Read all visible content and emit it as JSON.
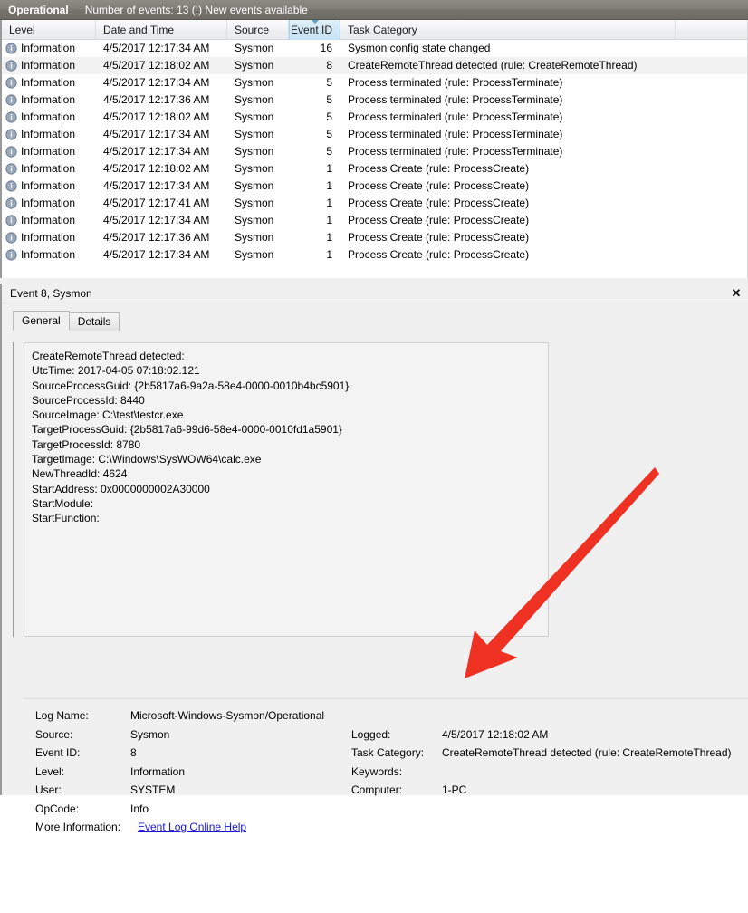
{
  "log_header": {
    "log_name": "Operational",
    "status": "Number of events: 13 (!) New events available"
  },
  "events_list": {
    "columns": [
      {
        "key": "level",
        "label": "Level"
      },
      {
        "key": "date",
        "label": "Date and Time"
      },
      {
        "key": "source",
        "label": "Source"
      },
      {
        "key": "event_id",
        "label": "Event ID"
      },
      {
        "key": "task",
        "label": "Task Category"
      }
    ],
    "sorted_column": "Event ID",
    "rows": [
      {
        "level": "Information",
        "date": "4/5/2017 12:17:34 AM",
        "source": "Sysmon",
        "event_id": "16",
        "task": "Sysmon config state changed",
        "selected": false
      },
      {
        "level": "Information",
        "date": "4/5/2017 12:18:02 AM",
        "source": "Sysmon",
        "event_id": "8",
        "task": "CreateRemoteThread detected (rule: CreateRemoteThread)",
        "selected": true
      },
      {
        "level": "Information",
        "date": "4/5/2017 12:17:34 AM",
        "source": "Sysmon",
        "event_id": "5",
        "task": "Process terminated (rule: ProcessTerminate)",
        "selected": false
      },
      {
        "level": "Information",
        "date": "4/5/2017 12:17:36 AM",
        "source": "Sysmon",
        "event_id": "5",
        "task": "Process terminated (rule: ProcessTerminate)",
        "selected": false
      },
      {
        "level": "Information",
        "date": "4/5/2017 12:18:02 AM",
        "source": "Sysmon",
        "event_id": "5",
        "task": "Process terminated (rule: ProcessTerminate)",
        "selected": false
      },
      {
        "level": "Information",
        "date": "4/5/2017 12:17:34 AM",
        "source": "Sysmon",
        "event_id": "5",
        "task": "Process terminated (rule: ProcessTerminate)",
        "selected": false
      },
      {
        "level": "Information",
        "date": "4/5/2017 12:17:34 AM",
        "source": "Sysmon",
        "event_id": "5",
        "task": "Process terminated (rule: ProcessTerminate)",
        "selected": false
      },
      {
        "level": "Information",
        "date": "4/5/2017 12:18:02 AM",
        "source": "Sysmon",
        "event_id": "1",
        "task": "Process Create (rule: ProcessCreate)",
        "selected": false
      },
      {
        "level": "Information",
        "date": "4/5/2017 12:17:34 AM",
        "source": "Sysmon",
        "event_id": "1",
        "task": "Process Create (rule: ProcessCreate)",
        "selected": false
      },
      {
        "level": "Information",
        "date": "4/5/2017 12:17:41 AM",
        "source": "Sysmon",
        "event_id": "1",
        "task": "Process Create (rule: ProcessCreate)",
        "selected": false
      },
      {
        "level": "Information",
        "date": "4/5/2017 12:17:34 AM",
        "source": "Sysmon",
        "event_id": "1",
        "task": "Process Create (rule: ProcessCreate)",
        "selected": false
      },
      {
        "level": "Information",
        "date": "4/5/2017 12:17:36 AM",
        "source": "Sysmon",
        "event_id": "1",
        "task": "Process Create (rule: ProcessCreate)",
        "selected": false
      },
      {
        "level": "Information",
        "date": "4/5/2017 12:17:34 AM",
        "source": "Sysmon",
        "event_id": "1",
        "task": "Process Create (rule: ProcessCreate)",
        "selected": false
      }
    ]
  },
  "detail": {
    "title": "Event 8, Sysmon",
    "close_label": "✕",
    "tabs": [
      {
        "label": "General",
        "active": true
      },
      {
        "label": "Details",
        "active": false
      }
    ],
    "message_lines": [
      "CreateRemoteThread detected:",
      "UtcTime: 2017-04-05 07:18:02.121",
      "SourceProcessGuid: {2b5817a6-9a2a-58e4-0000-0010b4bc5901}",
      "SourceProcessId: 8440",
      "SourceImage: C:\\test\\testcr.exe",
      "TargetProcessGuid: {2b5817a6-99d6-58e4-0000-0010fd1a5901}",
      "TargetProcessId: 8780",
      "TargetImage: C:\\Windows\\SysWOW64\\calc.exe",
      "NewThreadId: 4624",
      "StartAddress: 0x0000000002A30000",
      "StartModule:",
      "StartFunction:"
    ],
    "meta": {
      "log_name_label": "Log Name:",
      "log_name_value": "Microsoft-Windows-Sysmon/Operational",
      "source_label": "Source:",
      "source_value": "Sysmon",
      "logged_label": "Logged:",
      "logged_value": "4/5/2017 12:18:02 AM",
      "event_id_label": "Event ID:",
      "event_id_value": "8",
      "task_category_label": "Task Category:",
      "task_category_value": "CreateRemoteThread detected (rule: CreateRemoteThread)",
      "level_label": "Level:",
      "level_value": "Information",
      "keywords_label": "Keywords:",
      "keywords_value": "",
      "user_label": "User:",
      "user_value": "SYSTEM",
      "computer_label": "Computer:",
      "computer_value": "1-PC",
      "opcode_label": "OpCode:",
      "opcode_value": "Info",
      "more_info_label": "More Information:",
      "more_info_link": "Event Log Online Help"
    }
  },
  "annotation": {
    "arrow_color": "#ef3124"
  }
}
